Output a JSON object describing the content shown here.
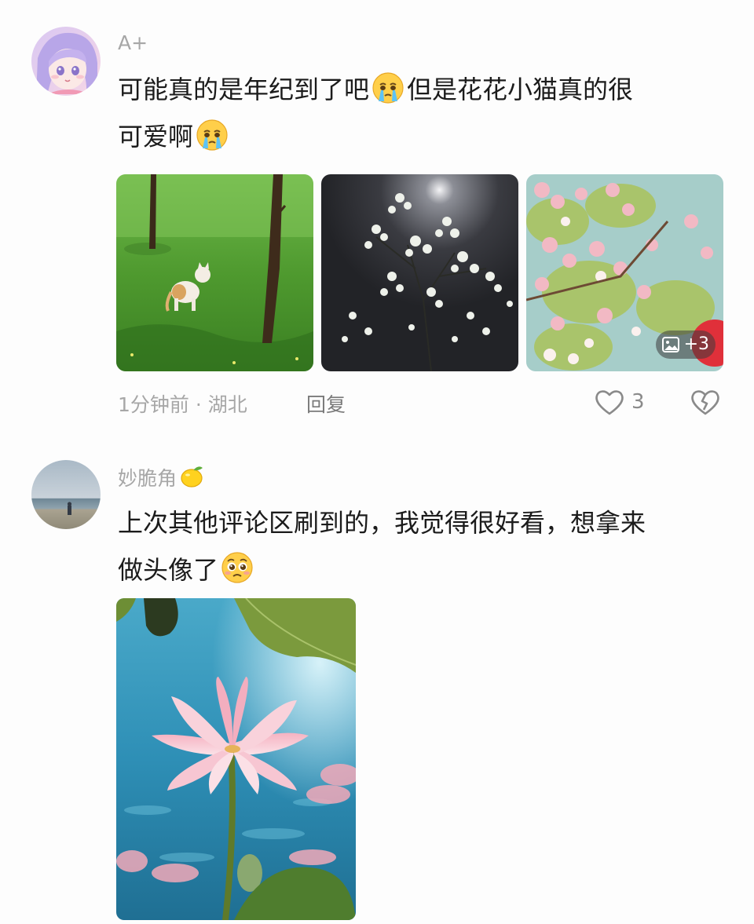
{
  "comments": [
    {
      "username": "A+",
      "text_lines": [
        "可能真的是年纪到了吧",
        "但是花花小猫真的很",
        "可爱啊"
      ],
      "emoji": "crying-face-icon",
      "images_extra": "+3",
      "time_location": "1分钟前 · 湖北",
      "reply_label": "回复",
      "like_count": "3"
    },
    {
      "username": "妙脆角",
      "username_emoji": "lemon-icon",
      "text_lines": [
        "上次其他评论区刷到的，我觉得很好看，想拿来",
        "做头像了"
      ],
      "emoji": "pleading-face-icon"
    }
  ],
  "colors": {
    "background": "#fdfdfd",
    "text": "#1b1b1b",
    "meta": "#a7a7a7"
  }
}
